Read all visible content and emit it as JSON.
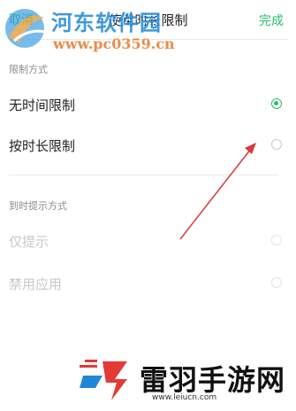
{
  "header": {
    "cancel_label": "取消",
    "title": "使用时长限制",
    "done_label": "完成"
  },
  "limit_section": {
    "label": "限制方式",
    "options": [
      {
        "label": "无时间限制",
        "selected": true
      },
      {
        "label": "按时长限制",
        "selected": false
      }
    ]
  },
  "notify_section": {
    "label": "到时提示方式",
    "options": [
      {
        "label": "仅提示",
        "enabled": false
      },
      {
        "label": "禁用应用",
        "enabled": false
      }
    ]
  },
  "watermarks": {
    "top_name": "河东软件园",
    "top_url": "www.pc0359.cn",
    "bottom_name": "雷羽手游网",
    "bottom_url": "www.leiucn.com"
  },
  "colors": {
    "accent": "#2dbb6a",
    "annotation_arrow": "#d93a3a"
  }
}
